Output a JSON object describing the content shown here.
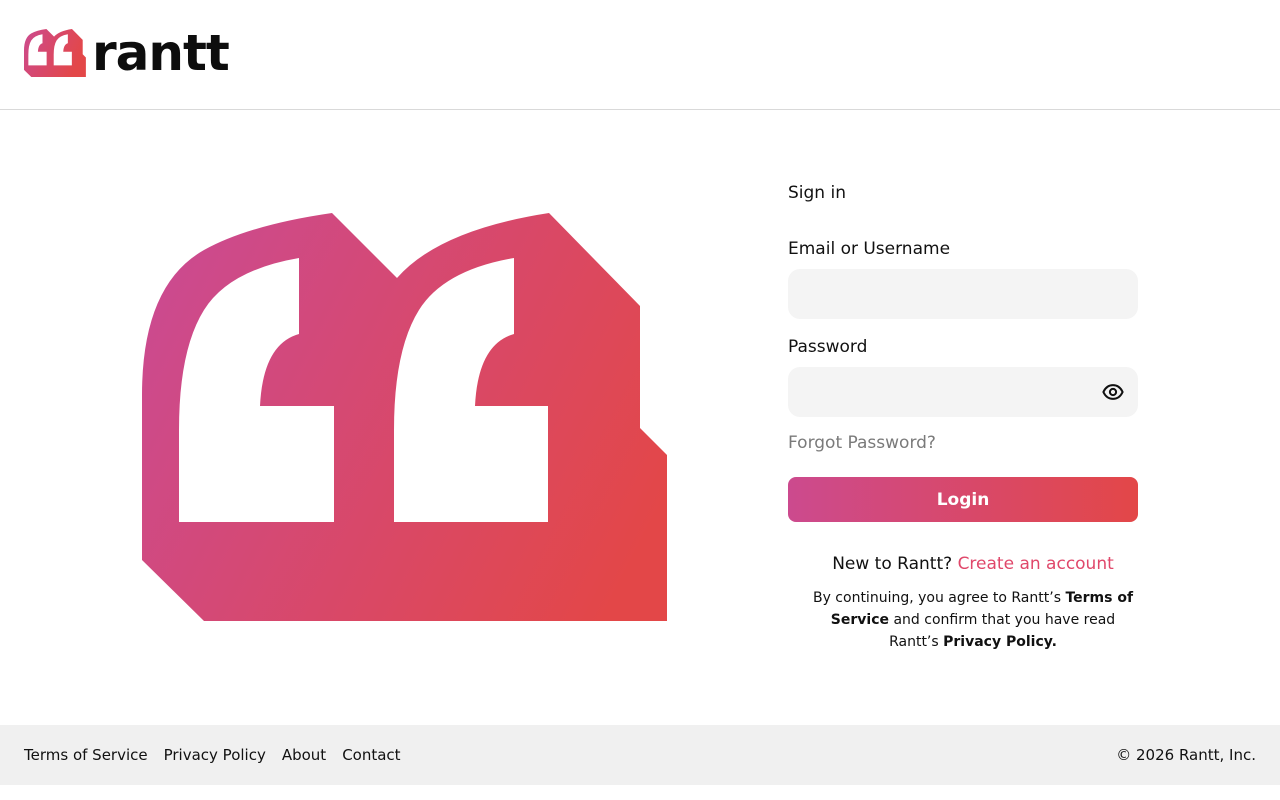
{
  "brand": {
    "wordmark": "rantt",
    "gradient": {
      "from": "#cc4a8e",
      "to": "#e34748"
    }
  },
  "signin": {
    "title": "Sign in",
    "email_label": "Email or Username",
    "email_value": "",
    "password_label": "Password",
    "password_value": "",
    "show_password_icon": "eye-icon",
    "forgot_label": "Forgot Password?",
    "login_label": "Login",
    "new_user_text": "New to Rantt?",
    "create_account_label": "Create an account",
    "terms": {
      "prefix": "By continuing, you agree to Rantt’s",
      "terms_link": "Terms of Service",
      "middle": "and confirm that you have read Rantt’s",
      "privacy_link": "Privacy Policy."
    }
  },
  "footer": {
    "links": [
      "Terms of Service",
      "Privacy Policy",
      "About",
      "Contact"
    ],
    "copyright": "© 2026 Rantt, Inc."
  }
}
